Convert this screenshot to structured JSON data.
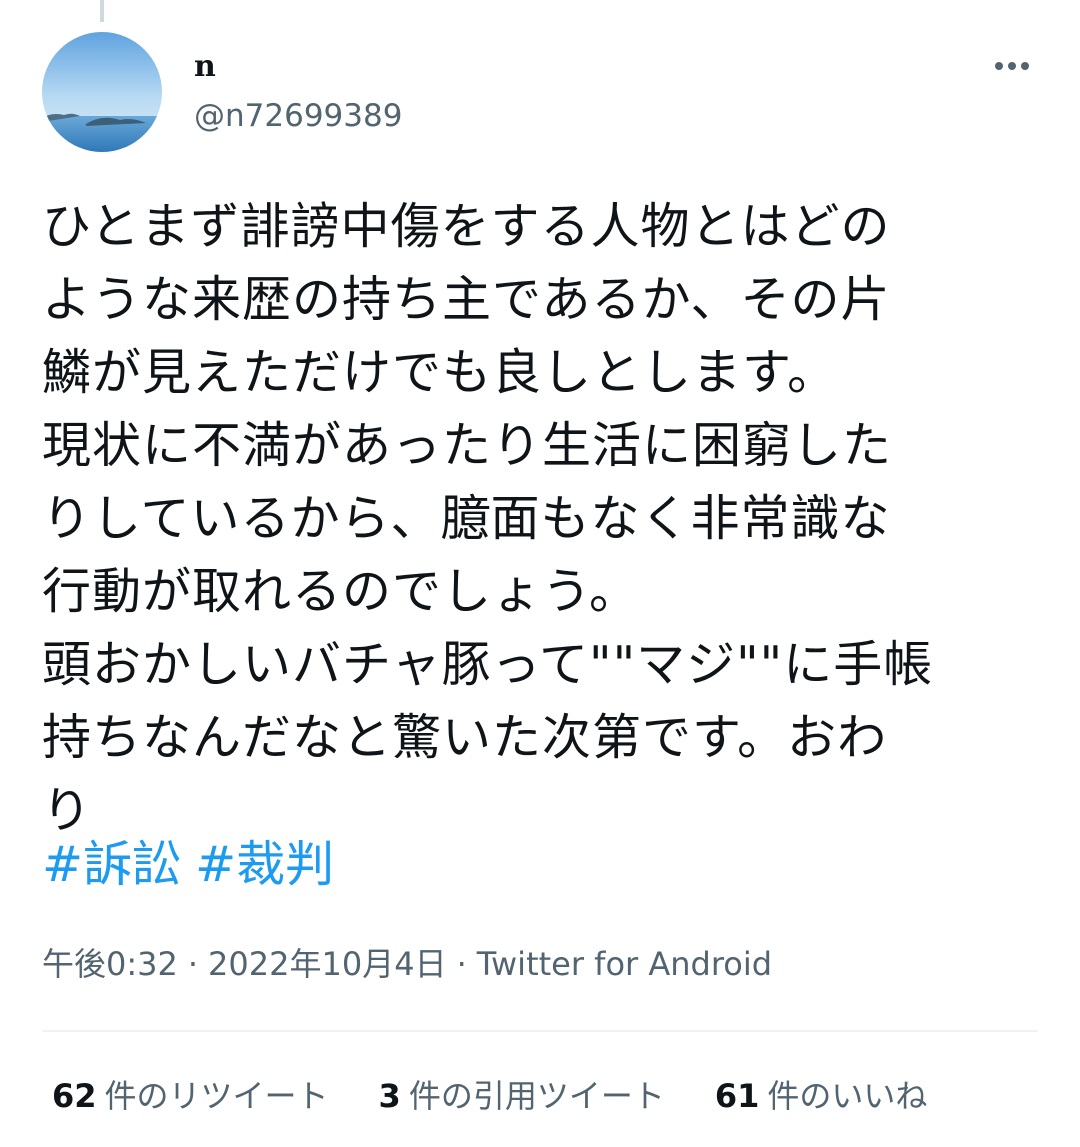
{
  "user": {
    "display_name": "n",
    "handle": "@n72699389"
  },
  "tweet": {
    "lines": [
      "ひとまず誹謗中傷をする人物とはどの",
      "ような来歴の持ち主であるか、その片",
      "鱗が見えただけでも良しとします。",
      "現状に不満があったり生活に困窮した",
      "りしているから、臆面もなく非常識な",
      "行動が取れるのでしょう。",
      "頭おかしいバチャ豚って\"\"マジ\"\"に手帳",
      "持ちなんだなと驚いた次第です。おわ",
      "り"
    ],
    "hashtags": [
      "#訴訟",
      "#裁判"
    ],
    "time": "午後0:32",
    "date": "2022年10月4日",
    "source": "Twitter for Android",
    "separator": "·"
  },
  "stats": {
    "retweets": {
      "count": "62",
      "label": "件のリツイート"
    },
    "quotes": {
      "count": "3",
      "label": "件の引用ツイート"
    },
    "likes": {
      "count": "61",
      "label": "件のいいね"
    }
  },
  "icons": {
    "more": "more-horizontal-icon",
    "avatar": "landscape-sea-avatar"
  },
  "colors": {
    "text": "#0f1419",
    "secondary": "#536471",
    "link": "#1d9bf0",
    "divider": "#eff3f4"
  }
}
